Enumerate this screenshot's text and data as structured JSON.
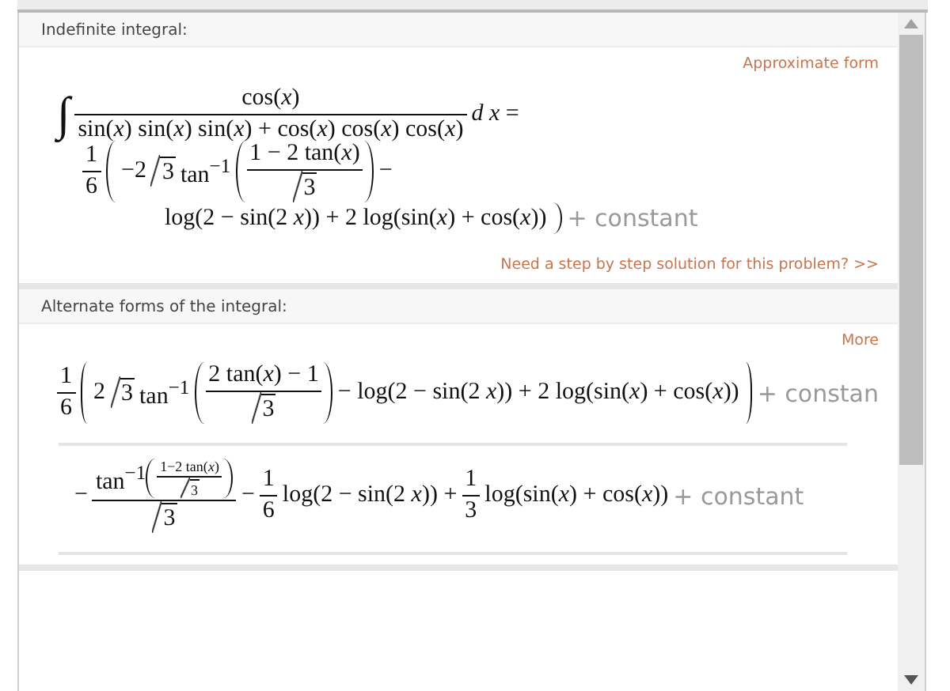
{
  "pods": [
    {
      "title": "Indefinite integral:",
      "link": "Approximate form",
      "footer_link": "Need a step by step solution for this problem?  >>",
      "forms": [
        {
          "lines": [
            {
              "kind": "first",
              "items": [
                {
                  "kind": "int",
                  "text": "∫"
                },
                {
                  "kind": "frac",
                  "num": [
                    {
                      "kind": "t",
                      "text": "cos(*x*)"
                    }
                  ],
                  "den": [
                    {
                      "kind": "t",
                      "text": "sin(*x*) sin(*x*) sin(*x*) + cos(*x*) cos(*x*) cos(*x*)"
                    }
                  ]
                },
                {
                  "kind": "t",
                  "text": "*d x* ="
                }
              ]
            },
            {
              "kind": "indented",
              "items": [
                {
                  "kind": "frac",
                  "num": [
                    {
                      "kind": "t",
                      "text": "1"
                    }
                  ],
                  "den": [
                    {
                      "kind": "t",
                      "text": "6"
                    }
                  ]
                },
                {
                  "kind": "lparen"
                },
                {
                  "kind": "t",
                  "text": "−2"
                },
                {
                  "kind": "sqrt",
                  "body": [
                    {
                      "kind": "t",
                      "text": "3"
                    }
                  ]
                },
                {
                  "kind": "t",
                  "text": "tan$^{−1}$"
                },
                {
                  "kind": "paren",
                  "body": [
                    {
                      "kind": "frac",
                      "num": [
                        {
                          "kind": "t",
                          "text": "1 − 2 tan(*x*)"
                        }
                      ],
                      "den": [
                        {
                          "kind": "sqrt",
                          "body": [
                            {
                              "kind": "t",
                              "text": "3"
                            }
                          ]
                        }
                      ]
                    }
                  ]
                },
                {
                  "kind": "t",
                  "text": "−"
                }
              ]
            },
            {
              "kind": "continuation",
              "items": [
                {
                  "kind": "t",
                  "text": "log(2 − sin(2 *x*)) + 2 log(sin(*x*) + cos(*x*))"
                },
                {
                  "kind": "rparen"
                },
                {
                  "kind": "const",
                  "text": "+ constant"
                }
              ]
            }
          ]
        }
      ]
    },
    {
      "title": "Alternate forms of the integral:",
      "link": "More",
      "forms": [
        {
          "lines": [
            {
              "kind": "first",
              "items": [
                {
                  "kind": "frac",
                  "num": [
                    {
                      "kind": "t",
                      "text": "1"
                    }
                  ],
                  "den": [
                    {
                      "kind": "t",
                      "text": "6"
                    }
                  ]
                },
                {
                  "kind": "lparen"
                },
                {
                  "kind": "t",
                  "text": "2"
                },
                {
                  "kind": "sqrt",
                  "body": [
                    {
                      "kind": "t",
                      "text": "3"
                    }
                  ]
                },
                {
                  "kind": "t",
                  "text": "tan$^{−1}$"
                },
                {
                  "kind": "paren",
                  "body": [
                    {
                      "kind": "frac",
                      "num": [
                        {
                          "kind": "t",
                          "text": "2 tan(*x*) − 1"
                        }
                      ],
                      "den": [
                        {
                          "kind": "sqrt",
                          "body": [
                            {
                              "kind": "t",
                              "text": "3"
                            }
                          ]
                        }
                      ]
                    }
                  ]
                },
                {
                  "kind": "t",
                  "text": "− log(2 − sin(2 *x*)) + 2 log(sin(*x*) + cos(*x*))"
                },
                {
                  "kind": "rparen"
                },
                {
                  "kind": "const",
                  "text": "+ constan"
                }
              ]
            }
          ]
        },
        {
          "lines": [
            {
              "kind": "first",
              "items": [
                {
                  "kind": "t",
                  "text": "−"
                },
                {
                  "kind": "frac",
                  "num": [
                    {
                      "kind": "t",
                      "text": "tan$^{−1}$"
                    },
                    {
                      "kind": "small",
                      "body": [
                        {
                          "kind": "paren",
                          "body": [
                            {
                              "kind": "frac",
                              "num": [
                                {
                                  "kind": "t",
                                  "text": "1−2 tan(*x*)"
                                }
                              ],
                              "den": [
                                {
                                  "kind": "sqrt",
                                  "body": [
                                    {
                                      "kind": "t",
                                      "text": "3"
                                    }
                                  ]
                                }
                              ]
                            }
                          ]
                        }
                      ]
                    }
                  ],
                  "den": [
                    {
                      "kind": "sqrt",
                      "body": [
                        {
                          "kind": "t",
                          "text": "3"
                        }
                      ]
                    }
                  ]
                },
                {
                  "kind": "t",
                  "text": "−"
                },
                {
                  "kind": "frac",
                  "num": [
                    {
                      "kind": "t",
                      "text": "1"
                    }
                  ],
                  "den": [
                    {
                      "kind": "t",
                      "text": "6"
                    }
                  ]
                },
                {
                  "kind": "t",
                  "text": "log(2 − sin(2 *x*)) +"
                },
                {
                  "kind": "frac",
                  "num": [
                    {
                      "kind": "t",
                      "text": "1"
                    }
                  ],
                  "den": [
                    {
                      "kind": "t",
                      "text": "3"
                    }
                  ]
                },
                {
                  "kind": "t",
                  "text": "log(sin(*x*) + cos(*x*))"
                },
                {
                  "kind": "const",
                  "text": "+ constant"
                }
              ]
            }
          ]
        }
      ]
    }
  ]
}
